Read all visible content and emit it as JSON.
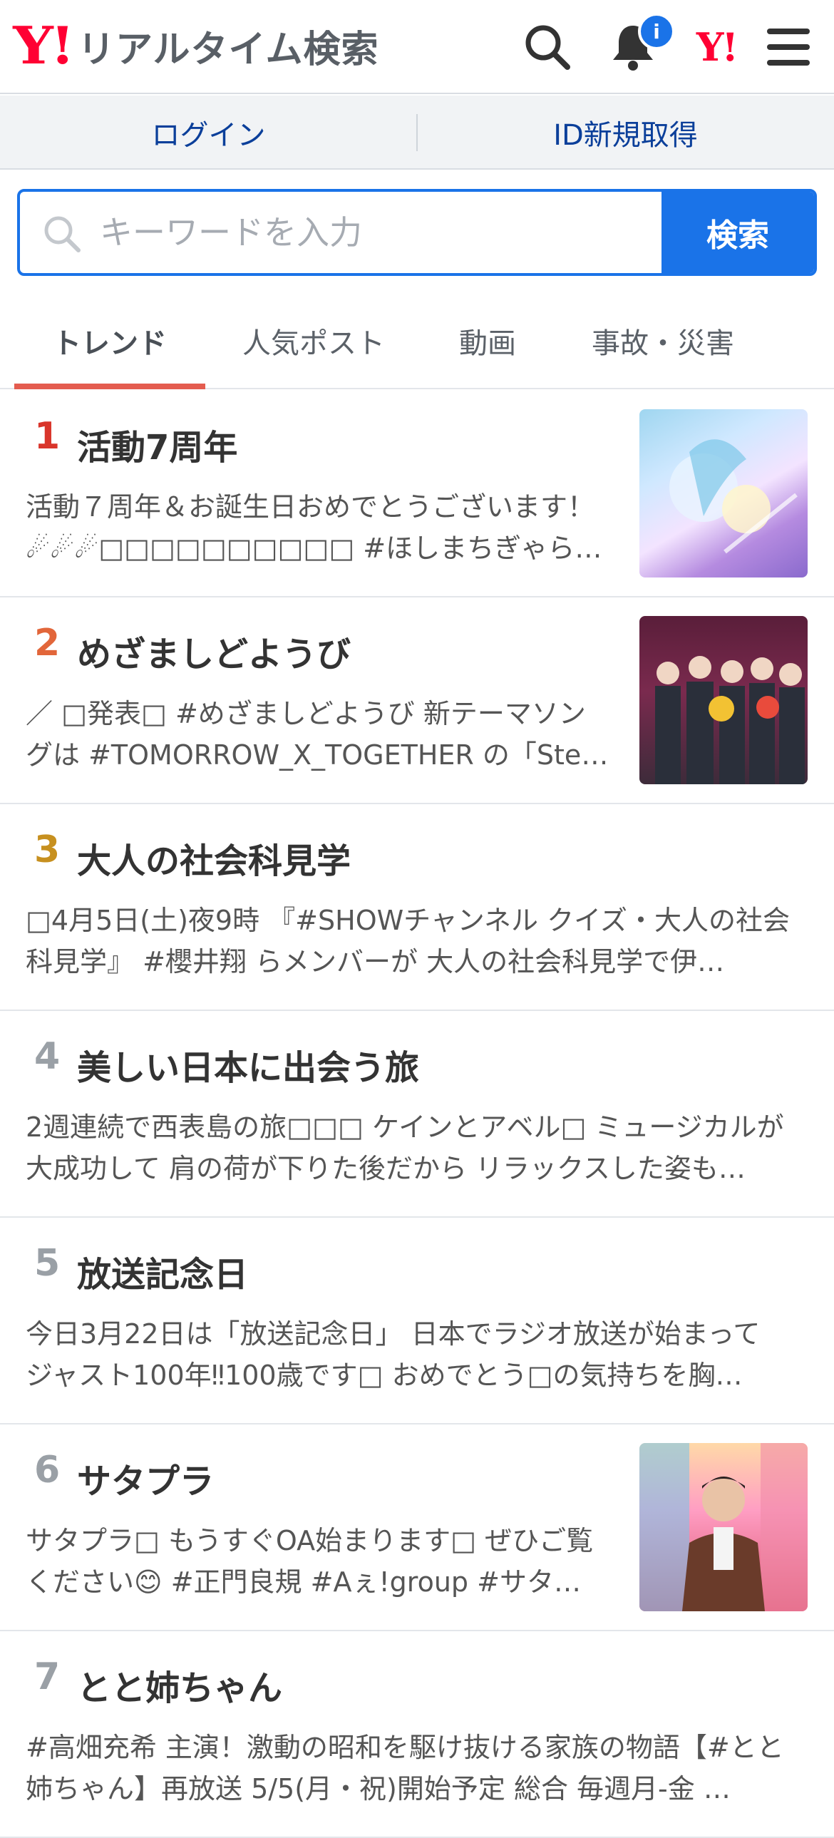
{
  "header": {
    "logo_mark": "Y!",
    "title": "リアルタイム検索",
    "notification_badge": "i",
    "yj_mark": "Y!"
  },
  "account": {
    "login_label": "ログイン",
    "signup_label": "ID新規取得"
  },
  "search": {
    "placeholder": "キーワードを入力",
    "button_label": "検索"
  },
  "tabs": [
    {
      "label": "トレンド",
      "active": true
    },
    {
      "label": "人気ポスト",
      "active": false
    },
    {
      "label": "動画",
      "active": false
    },
    {
      "label": "事故・災害",
      "active": false
    }
  ],
  "colors": {
    "accent": "#1a73e8",
    "brand": "#ff0033",
    "rank1": "#d9352b",
    "rank2": "#e2663a",
    "rank3": "#c7901f",
    "rank_other": "#9aa0a6",
    "tab_underline": "#e45c4f"
  },
  "trends": [
    {
      "rank": "1",
      "title": "活動7周年",
      "desc": "活動７周年＆お誕生日おめでとうございます！ ☄☄☄□□□□□□□□□□ #ほしまちぎゃらりー…",
      "has_thumb": true
    },
    {
      "rank": "2",
      "title": "めざましどようび",
      "desc": "／ □発表□ #めざましどようび 新テーマソングは #TOMORROW_X_TOGETHER の「Ste…",
      "has_thumb": true
    },
    {
      "rank": "3",
      "title": "大人の社会科見学",
      "desc": "□4月5日(土)夜9時 『#SHOWチャンネル クイズ・大人の社会科見学』 #櫻井翔 らメンバーが 大人の社会科見学で伊…",
      "has_thumb": false
    },
    {
      "rank": "4",
      "title": "美しい日本に出会う旅",
      "desc": "2週連続で西表島の旅□□□ ケインとアベル□ ミュージカルが大成功して 肩の荷が下りた後だから リラックスした姿も…",
      "has_thumb": false
    },
    {
      "rank": "5",
      "title": "放送記念日",
      "desc": "今日3月22日は「放送記念日」 日本でラジオ放送が始まって ジャスト100年‼100歳です□ おめでとう□の気持ちを胸…",
      "has_thumb": false
    },
    {
      "rank": "6",
      "title": "サタプラ",
      "desc": "サタプラ□ もうすぐOA始まります□ ぜひご覧ください😊 #正門良規 #Aぇ!group #サタ…",
      "has_thumb": true
    },
    {
      "rank": "7",
      "title": "とと姉ちゃん",
      "desc": "#高畑充希 主演！激動の昭和を駆け抜ける家族の物語【#とと姉ちゃん】再放送 5/5(月・祝)開始予定 総合 毎週月-金 …",
      "has_thumb": false
    }
  ]
}
